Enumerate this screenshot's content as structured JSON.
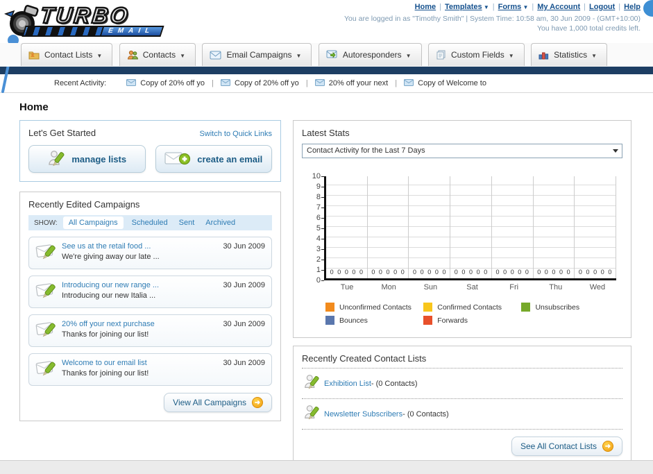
{
  "header": {
    "logo_title": "TURBO",
    "logo_subtitle": "EMAIL",
    "nav_links": [
      {
        "label": "Home",
        "dropdown": false
      },
      {
        "label": "Templates",
        "dropdown": true
      },
      {
        "label": "Forms",
        "dropdown": true
      },
      {
        "label": "My Account",
        "dropdown": false
      },
      {
        "label": "Logout",
        "dropdown": false
      },
      {
        "label": "Help",
        "dropdown": false
      }
    ],
    "login_info": "You are logged in as \"Timothy Smith\" | System Time: 10:58 am, 30 Jun 2009 - (GMT+10:00)",
    "credits_info": "You have 1,000 total credits left."
  },
  "nav_tabs": [
    {
      "label": "Contact Lists",
      "icon": "contact-lists-folder-icon"
    },
    {
      "label": "Contacts",
      "icon": "contacts-people-icon"
    },
    {
      "label": "Email Campaigns",
      "icon": "email-envelope-icon"
    },
    {
      "label": "Autoresponders",
      "icon": "autoresponder-envelope-icon"
    },
    {
      "label": "Custom Fields",
      "icon": "custom-fields-pages-icon"
    },
    {
      "label": "Statistics",
      "icon": "statistics-chart-icon"
    }
  ],
  "recent_activity": {
    "label": "Recent Activity:",
    "items": [
      "Copy of 20% off yo",
      "Copy of 20% off yo",
      "20% off your next",
      "Copy of Welcome to"
    ]
  },
  "page_title": "Home",
  "get_started": {
    "title": "Let's Get Started",
    "switch_link": "Switch to Quick Links",
    "manage_lists_label": "manage lists",
    "create_email_label": "create an email"
  },
  "campaigns": {
    "title": "Recently Edited Campaigns",
    "show_label": "SHOW:",
    "filters": [
      "All Campaigns",
      "Scheduled",
      "Sent",
      "Archived"
    ],
    "active_filter": "All Campaigns",
    "items": [
      {
        "title": "See us at the retail food ...",
        "subtitle": "We're giving away our late ...",
        "date": "30 Jun 2009"
      },
      {
        "title": "Introducing our new range ...",
        "subtitle": "Introducing our new Italia ...",
        "date": "30 Jun 2009"
      },
      {
        "title": "20% off your next purchase",
        "subtitle": "Thanks for joining our list!",
        "date": "30 Jun 2009"
      },
      {
        "title": "Welcome to our email list",
        "subtitle": "Thanks for joining our list!",
        "date": "30 Jun 2009"
      }
    ],
    "view_all_label": "View All Campaigns"
  },
  "stats": {
    "title": "Latest Stats",
    "selected_option": "Contact Activity for the Last 7 Days"
  },
  "chart_data": {
    "type": "bar",
    "title": "Contact Activity for the Last 7 Days",
    "categories": [
      "Tue",
      "Mon",
      "Sun",
      "Sat",
      "Fri",
      "Thu",
      "Wed"
    ],
    "series": [
      {
        "name": "Unconfirmed Contacts",
        "color": "#f28b1d",
        "values": [
          0,
          0,
          0,
          0,
          0,
          0,
          0
        ]
      },
      {
        "name": "Confirmed Contacts",
        "color": "#f8c61c",
        "values": [
          0,
          0,
          0,
          0,
          0,
          0,
          0
        ]
      },
      {
        "name": "Unsubscribes",
        "color": "#76a92a",
        "values": [
          0,
          0,
          0,
          0,
          0,
          0,
          0
        ]
      },
      {
        "name": "Bounces",
        "color": "#5a77ad",
        "values": [
          0,
          0,
          0,
          0,
          0,
          0,
          0
        ]
      },
      {
        "name": "Forwards",
        "color": "#e8502b",
        "values": [
          0,
          0,
          0,
          0,
          0,
          0,
          0
        ]
      }
    ],
    "ylim": [
      0,
      10
    ],
    "yticks": [
      0,
      1,
      2,
      3,
      4,
      5,
      6,
      7,
      8,
      9,
      10
    ],
    "grid": true,
    "legend_position": "bottom",
    "value_labels": "0"
  },
  "contact_lists": {
    "title": "Recently Created Contact Lists",
    "items": [
      {
        "name": "Exhibition List",
        "suffix": " - (0 Contacts)"
      },
      {
        "name": "Newsletter Subscribers",
        "suffix": " - (0 Contacts)"
      }
    ],
    "see_all_label": "See All Contact Lists"
  }
}
